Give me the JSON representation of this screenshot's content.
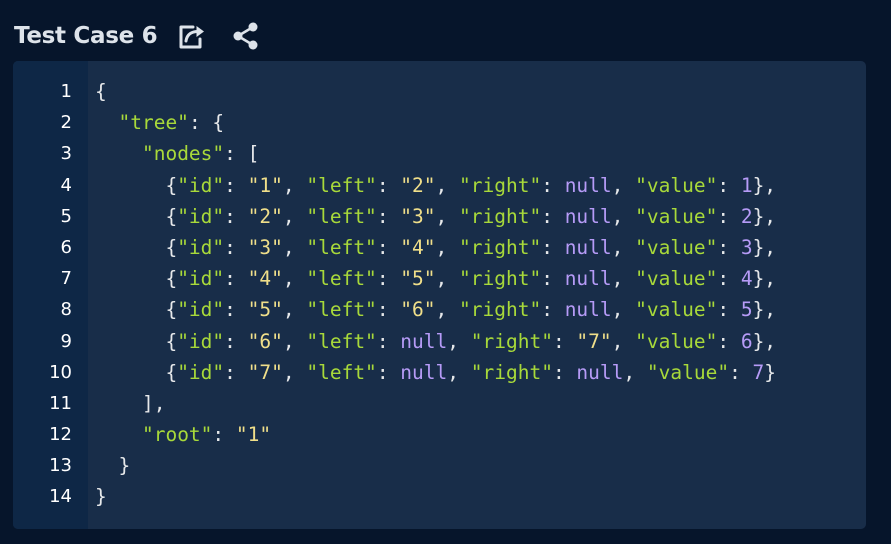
{
  "header": {
    "title": "Test Case 6",
    "icons": [
      "share-icon",
      "network-share-icon"
    ]
  },
  "colors": {
    "background": "#06152b",
    "editor_bg": "#182d49",
    "gutter_bg": "#0e2746",
    "key": "#a8d93a",
    "string": "#f0df8a",
    "number": "#b69bf7",
    "punctuation": "#e6e8ea"
  },
  "editor": {
    "lines": [
      {
        "n": "1",
        "tokens": [
          {
            "t": "{",
            "c": "p"
          }
        ]
      },
      {
        "n": "2",
        "tokens": [
          {
            "t": "  ",
            "c": "p"
          },
          {
            "t": "\"tree\"",
            "c": "k"
          },
          {
            "t": ": {",
            "c": "p"
          }
        ]
      },
      {
        "n": "3",
        "tokens": [
          {
            "t": "    ",
            "c": "p"
          },
          {
            "t": "\"nodes\"",
            "c": "k"
          },
          {
            "t": ": [",
            "c": "p"
          }
        ]
      },
      {
        "n": "4",
        "tokens": [
          {
            "t": "      {",
            "c": "p"
          },
          {
            "t": "\"id\"",
            "c": "k"
          },
          {
            "t": ": ",
            "c": "p"
          },
          {
            "t": "\"1\"",
            "c": "s"
          },
          {
            "t": ", ",
            "c": "p"
          },
          {
            "t": "\"left\"",
            "c": "k"
          },
          {
            "t": ": ",
            "c": "p"
          },
          {
            "t": "\"2\"",
            "c": "s"
          },
          {
            "t": ", ",
            "c": "p"
          },
          {
            "t": "\"right\"",
            "c": "k"
          },
          {
            "t": ": ",
            "c": "p"
          },
          {
            "t": "null",
            "c": "kw"
          },
          {
            "t": ", ",
            "c": "p"
          },
          {
            "t": "\"value\"",
            "c": "k"
          },
          {
            "t": ": ",
            "c": "p"
          },
          {
            "t": "1",
            "c": "n"
          },
          {
            "t": "},",
            "c": "p"
          }
        ]
      },
      {
        "n": "5",
        "tokens": [
          {
            "t": "      {",
            "c": "p"
          },
          {
            "t": "\"id\"",
            "c": "k"
          },
          {
            "t": ": ",
            "c": "p"
          },
          {
            "t": "\"2\"",
            "c": "s"
          },
          {
            "t": ", ",
            "c": "p"
          },
          {
            "t": "\"left\"",
            "c": "k"
          },
          {
            "t": ": ",
            "c": "p"
          },
          {
            "t": "\"3\"",
            "c": "s"
          },
          {
            "t": ", ",
            "c": "p"
          },
          {
            "t": "\"right\"",
            "c": "k"
          },
          {
            "t": ": ",
            "c": "p"
          },
          {
            "t": "null",
            "c": "kw"
          },
          {
            "t": ", ",
            "c": "p"
          },
          {
            "t": "\"value\"",
            "c": "k"
          },
          {
            "t": ": ",
            "c": "p"
          },
          {
            "t": "2",
            "c": "n"
          },
          {
            "t": "},",
            "c": "p"
          }
        ]
      },
      {
        "n": "6",
        "tokens": [
          {
            "t": "      {",
            "c": "p"
          },
          {
            "t": "\"id\"",
            "c": "k"
          },
          {
            "t": ": ",
            "c": "p"
          },
          {
            "t": "\"3\"",
            "c": "s"
          },
          {
            "t": ", ",
            "c": "p"
          },
          {
            "t": "\"left\"",
            "c": "k"
          },
          {
            "t": ": ",
            "c": "p"
          },
          {
            "t": "\"4\"",
            "c": "s"
          },
          {
            "t": ", ",
            "c": "p"
          },
          {
            "t": "\"right\"",
            "c": "k"
          },
          {
            "t": ": ",
            "c": "p"
          },
          {
            "t": "null",
            "c": "kw"
          },
          {
            "t": ", ",
            "c": "p"
          },
          {
            "t": "\"value\"",
            "c": "k"
          },
          {
            "t": ": ",
            "c": "p"
          },
          {
            "t": "3",
            "c": "n"
          },
          {
            "t": "},",
            "c": "p"
          }
        ]
      },
      {
        "n": "7",
        "tokens": [
          {
            "t": "      {",
            "c": "p"
          },
          {
            "t": "\"id\"",
            "c": "k"
          },
          {
            "t": ": ",
            "c": "p"
          },
          {
            "t": "\"4\"",
            "c": "s"
          },
          {
            "t": ", ",
            "c": "p"
          },
          {
            "t": "\"left\"",
            "c": "k"
          },
          {
            "t": ": ",
            "c": "p"
          },
          {
            "t": "\"5\"",
            "c": "s"
          },
          {
            "t": ", ",
            "c": "p"
          },
          {
            "t": "\"right\"",
            "c": "k"
          },
          {
            "t": ": ",
            "c": "p"
          },
          {
            "t": "null",
            "c": "kw"
          },
          {
            "t": ", ",
            "c": "p"
          },
          {
            "t": "\"value\"",
            "c": "k"
          },
          {
            "t": ": ",
            "c": "p"
          },
          {
            "t": "4",
            "c": "n"
          },
          {
            "t": "},",
            "c": "p"
          }
        ]
      },
      {
        "n": "8",
        "tokens": [
          {
            "t": "      {",
            "c": "p"
          },
          {
            "t": "\"id\"",
            "c": "k"
          },
          {
            "t": ": ",
            "c": "p"
          },
          {
            "t": "\"5\"",
            "c": "s"
          },
          {
            "t": ", ",
            "c": "p"
          },
          {
            "t": "\"left\"",
            "c": "k"
          },
          {
            "t": ": ",
            "c": "p"
          },
          {
            "t": "\"6\"",
            "c": "s"
          },
          {
            "t": ", ",
            "c": "p"
          },
          {
            "t": "\"right\"",
            "c": "k"
          },
          {
            "t": ": ",
            "c": "p"
          },
          {
            "t": "null",
            "c": "kw"
          },
          {
            "t": ", ",
            "c": "p"
          },
          {
            "t": "\"value\"",
            "c": "k"
          },
          {
            "t": ": ",
            "c": "p"
          },
          {
            "t": "5",
            "c": "n"
          },
          {
            "t": "},",
            "c": "p"
          }
        ]
      },
      {
        "n": "9",
        "tokens": [
          {
            "t": "      {",
            "c": "p"
          },
          {
            "t": "\"id\"",
            "c": "k"
          },
          {
            "t": ": ",
            "c": "p"
          },
          {
            "t": "\"6\"",
            "c": "s"
          },
          {
            "t": ", ",
            "c": "p"
          },
          {
            "t": "\"left\"",
            "c": "k"
          },
          {
            "t": ": ",
            "c": "p"
          },
          {
            "t": "null",
            "c": "kw"
          },
          {
            "t": ", ",
            "c": "p"
          },
          {
            "t": "\"right\"",
            "c": "k"
          },
          {
            "t": ": ",
            "c": "p"
          },
          {
            "t": "\"7\"",
            "c": "s"
          },
          {
            "t": ", ",
            "c": "p"
          },
          {
            "t": "\"value\"",
            "c": "k"
          },
          {
            "t": ": ",
            "c": "p"
          },
          {
            "t": "6",
            "c": "n"
          },
          {
            "t": "},",
            "c": "p"
          }
        ]
      },
      {
        "n": "10",
        "tokens": [
          {
            "t": "      {",
            "c": "p"
          },
          {
            "t": "\"id\"",
            "c": "k"
          },
          {
            "t": ": ",
            "c": "p"
          },
          {
            "t": "\"7\"",
            "c": "s"
          },
          {
            "t": ", ",
            "c": "p"
          },
          {
            "t": "\"left\"",
            "c": "k"
          },
          {
            "t": ": ",
            "c": "p"
          },
          {
            "t": "null",
            "c": "kw"
          },
          {
            "t": ", ",
            "c": "p"
          },
          {
            "t": "\"right\"",
            "c": "k"
          },
          {
            "t": ": ",
            "c": "p"
          },
          {
            "t": "null",
            "c": "kw"
          },
          {
            "t": ", ",
            "c": "p"
          },
          {
            "t": "\"value\"",
            "c": "k"
          },
          {
            "t": ": ",
            "c": "p"
          },
          {
            "t": "7",
            "c": "n"
          },
          {
            "t": "}",
            "c": "p"
          }
        ]
      },
      {
        "n": "11",
        "tokens": [
          {
            "t": "    ],",
            "c": "p"
          }
        ]
      },
      {
        "n": "12",
        "tokens": [
          {
            "t": "    ",
            "c": "p"
          },
          {
            "t": "\"root\"",
            "c": "k"
          },
          {
            "t": ": ",
            "c": "p"
          },
          {
            "t": "\"1\"",
            "c": "s"
          }
        ]
      },
      {
        "n": "13",
        "tokens": [
          {
            "t": "  }",
            "c": "p"
          }
        ]
      },
      {
        "n": "14",
        "tokens": [
          {
            "t": "}",
            "c": "p"
          }
        ]
      }
    ]
  }
}
